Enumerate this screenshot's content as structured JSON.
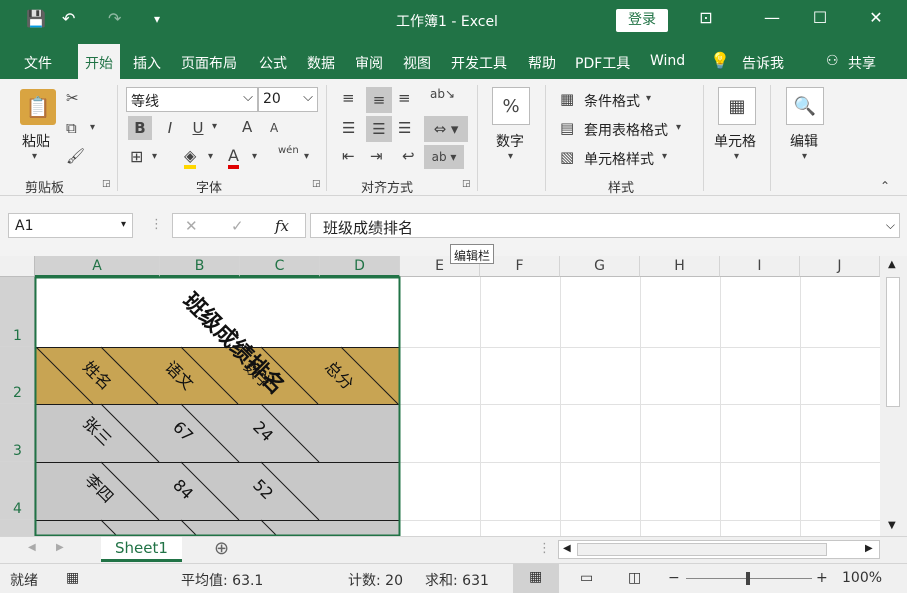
{
  "window": {
    "title": "工作簿1  -  Excel",
    "login": "登录",
    "qat": {
      "save": "💾",
      "undo": "↶",
      "redo": "↷",
      "customize": "▾"
    },
    "controls": {
      "ribbon_display": "⊡",
      "minimize": "—",
      "maximize": "☐",
      "close": "✕"
    }
  },
  "menu": [
    "文件",
    "开始",
    "插入",
    "页面布局",
    "公式",
    "数据",
    "审阅",
    "视图",
    "开发工具",
    "帮助",
    "PDF工具",
    "Wind"
  ],
  "menu_active": 1,
  "tell_me": "告诉我",
  "share": "共享",
  "ribbon": {
    "clipboard": {
      "paste": "粘贴",
      "label": "剪贴板"
    },
    "font": {
      "name": "等线",
      "size": "20",
      "bold": "B",
      "italic": "I",
      "underline": "U",
      "increase": "A",
      "decrease": "A",
      "label": "字体",
      "wen": "wén"
    },
    "alignment": {
      "label": "对齐方式"
    },
    "number": {
      "symbol": "%",
      "label": "数字"
    },
    "styles": {
      "conditional": "条件格式",
      "table": "套用表格格式",
      "cell": "单元格样式",
      "label": "样式"
    },
    "cells": {
      "label": "单元格"
    },
    "editing": {
      "label": "编辑"
    }
  },
  "formula_bar": {
    "name_box": "A1",
    "cancel": "✕",
    "enter": "✓",
    "fx": "fx",
    "content": "班级成绩排名",
    "tooltip": "编辑栏"
  },
  "columns": [
    "A",
    "B",
    "C",
    "D",
    "E",
    "F",
    "G",
    "H",
    "I",
    "J"
  ],
  "rows": [
    "1",
    "2",
    "3",
    "4"
  ],
  "cells": {
    "title": "班级成绩排名",
    "headers": [
      "姓名",
      "语文",
      "数学",
      "总分"
    ],
    "rows": [
      [
        "张三",
        "67",
        "24"
      ],
      [
        "李四",
        "84",
        "52"
      ]
    ]
  },
  "colors": {
    "excel_green": "#217346",
    "header_fill": "#c8a453",
    "data_fill": "#c8c8c8"
  },
  "sheet_tab": "Sheet1",
  "status": {
    "ready": "就绪",
    "average": "平均值: 63.1",
    "count": "计数: 20",
    "sum": "求和: 631",
    "zoom": "100%"
  }
}
